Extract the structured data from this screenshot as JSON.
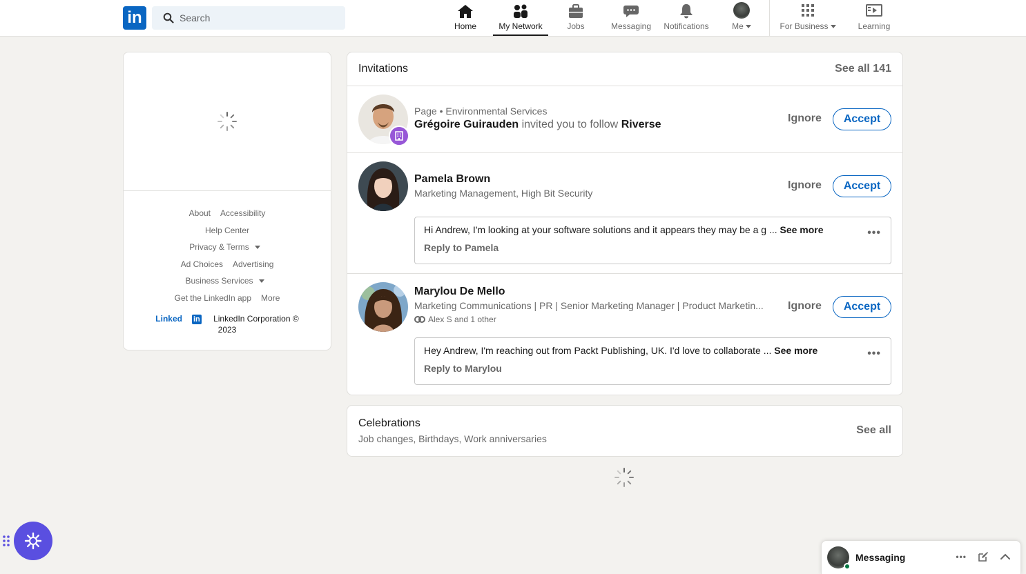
{
  "header": {
    "logo_text": "in",
    "search_placeholder": "Search",
    "nav": {
      "home": "Home",
      "my_network": "My Network",
      "jobs": "Jobs",
      "messaging": "Messaging",
      "notifications": "Notifications",
      "me": "Me",
      "for_business": "For Business",
      "learning": "Learning"
    }
  },
  "footer": {
    "about": "About",
    "accessibility": "Accessibility",
    "help_center": "Help Center",
    "privacy_terms": "Privacy & Terms",
    "ad_choices": "Ad Choices",
    "advertising": "Advertising",
    "business_services": "Business Services",
    "get_app": "Get the LinkedIn app",
    "more": "More",
    "brand_word": "Linked",
    "brand_in": "in",
    "corp_line1": "LinkedIn Corporation ©",
    "corp_line2": "2023"
  },
  "invitations": {
    "title": "Invitations",
    "see_all": "See all 141",
    "ignore_label": "Ignore",
    "accept_label": "Accept",
    "items": [
      {
        "meta_prefix": "Page",
        "meta_separator": "•",
        "meta_category": "Environmental Services",
        "inviter": "Grégoire Guirauden",
        "action": "invited you to follow",
        "target": "Riverse"
      },
      {
        "name": "Pamela Brown",
        "headline": "Marketing Management, High Bit Security",
        "message": "Hi Andrew, I'm looking at your software solutions and it appears they may be a g ...",
        "see_more": "See more",
        "reply": "Reply to Pamela"
      },
      {
        "name": "Marylou De Mello",
        "headline": "Marketing Communications | PR | Senior Marketing Manager | Product Marketin...",
        "mutual": "Alex S and 1 other",
        "message": "Hey Andrew, I'm reaching out from Packt Publishing, UK. I'd love to collaborate ...",
        "see_more": "See more",
        "reply": "Reply to Marylou"
      }
    ]
  },
  "celebrations": {
    "title": "Celebrations",
    "subtitle": "Job changes, Birthdays, Work anniversaries",
    "see_all": "See all"
  },
  "messaging_bar": {
    "title": "Messaging"
  },
  "colors": {
    "brand_blue": "#0a66c2",
    "background": "#f3f2ef",
    "widget_purple": "#5a4fe0",
    "online_green": "#057642"
  }
}
